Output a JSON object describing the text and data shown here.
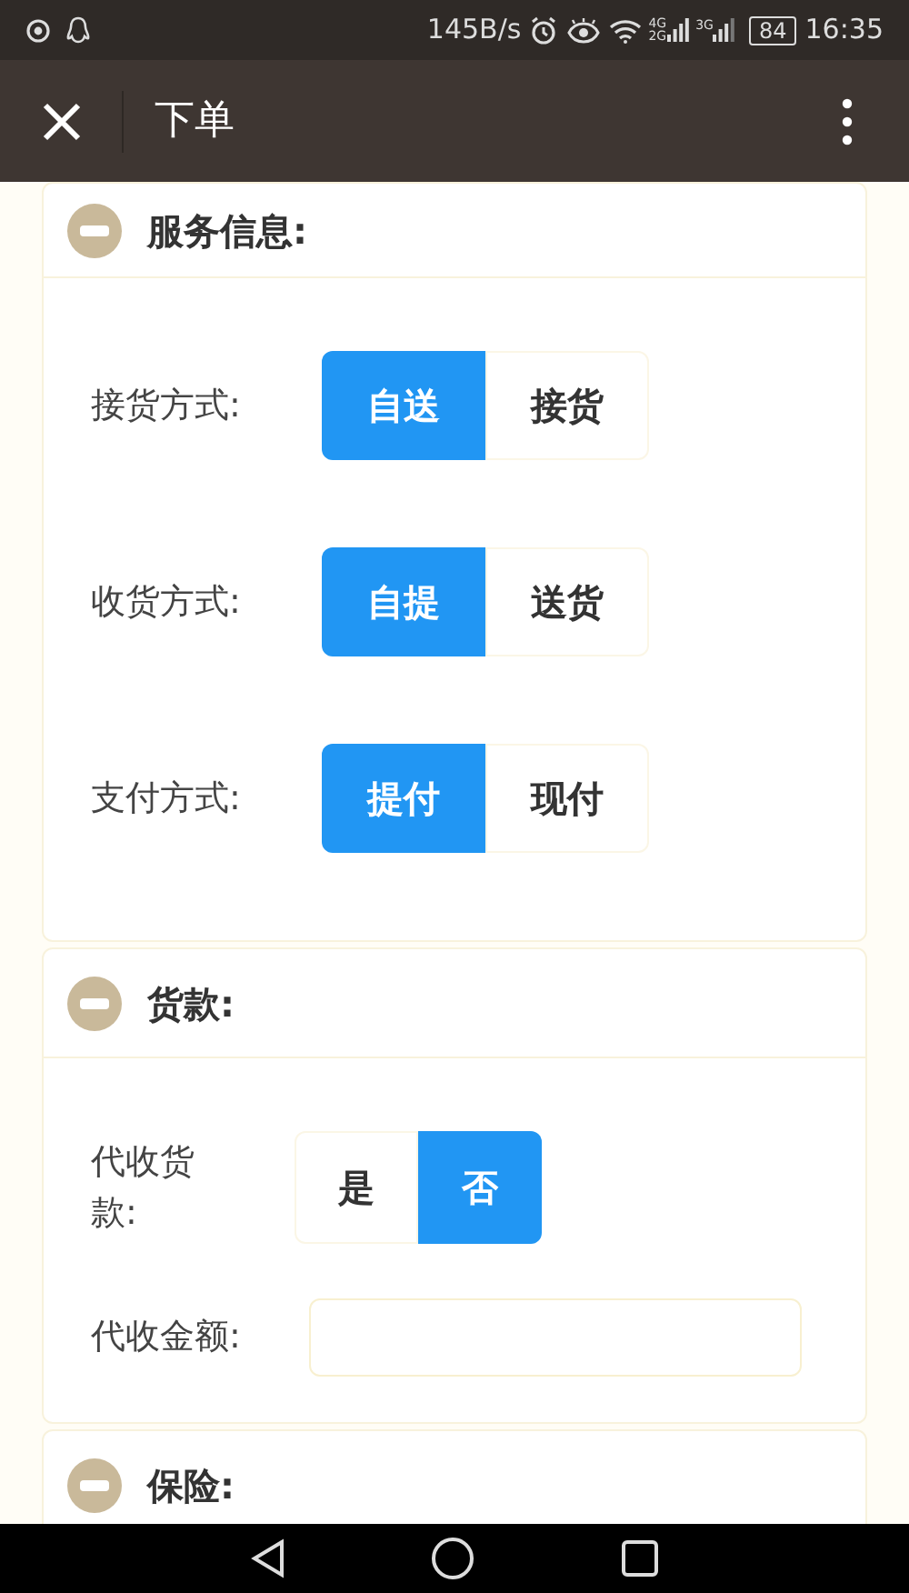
{
  "status_bar": {
    "network_speed": "145B/s",
    "signal_1_labels": [
      "4G",
      "2G"
    ],
    "signal_2_label": "3G",
    "battery": "84",
    "time": "16:35"
  },
  "app_bar": {
    "title": "下单"
  },
  "sections": [
    {
      "title": "服务信息:",
      "expanded": true,
      "rows": [
        {
          "kind": "toggle",
          "label": "接货方式:",
          "options": [
            {
              "label": "自送",
              "selected": true
            },
            {
              "label": "接货",
              "selected": false
            }
          ]
        },
        {
          "kind": "toggle",
          "label": "收货方式:",
          "options": [
            {
              "label": "自提",
              "selected": true
            },
            {
              "label": "送货",
              "selected": false
            }
          ]
        },
        {
          "kind": "toggle",
          "label": "支付方式:",
          "options": [
            {
              "label": "提付",
              "selected": true
            },
            {
              "label": "现付",
              "selected": false
            }
          ]
        }
      ]
    },
    {
      "title": "货款:",
      "expanded": true,
      "rows": [
        {
          "kind": "toggle",
          "label": "代收货款:",
          "options": [
            {
              "label": "是",
              "selected": false
            },
            {
              "label": "否",
              "selected": true
            }
          ]
        },
        {
          "kind": "input",
          "label": "代收金额:"
        }
      ]
    },
    {
      "title": "保险:",
      "expanded": true
    }
  ]
}
